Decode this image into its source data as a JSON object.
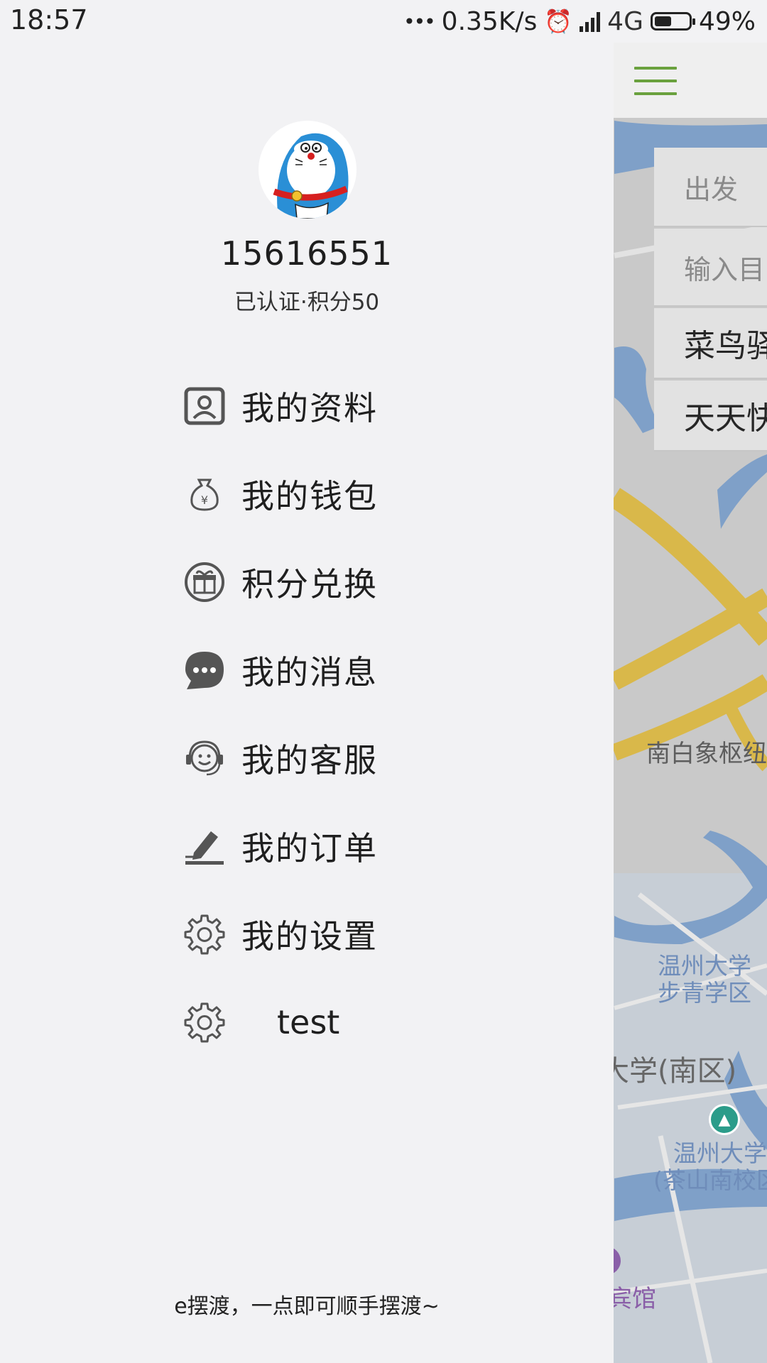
{
  "status_bar": {
    "time": "18:57",
    "more": "•••",
    "net_speed": "0.35K/s",
    "network": "4G",
    "battery": "49%",
    "battery_level": 0.49
  },
  "drawer": {
    "username": "15616551",
    "meta": "已认证·积分50",
    "menu": [
      {
        "label": "我的资料",
        "icon": "profile-card-icon"
      },
      {
        "label": "我的钱包",
        "icon": "money-bag-icon"
      },
      {
        "label": "积分兑换",
        "icon": "gift-icon"
      },
      {
        "label": "我的消息",
        "icon": "message-bubble-icon"
      },
      {
        "label": "我的客服",
        "icon": "customer-service-icon"
      },
      {
        "label": "我的订单",
        "icon": "pen-order-icon"
      },
      {
        "label": "我的设置",
        "icon": "gear-icon"
      },
      {
        "label": "test",
        "icon": "gear-icon"
      }
    ],
    "slogan": "e摆渡，一点即可顺手摆渡~"
  },
  "map_view": {
    "route_cards": [
      "出发",
      "输入目",
      "菜鸟驿",
      "天天快"
    ],
    "labels": [
      "南白象枢纽",
      "温州大学",
      "步青学区",
      "大学(南区)",
      "温州大学",
      "(茶山南校区",
      "宾馆"
    ]
  },
  "colors": {
    "drawer_bg": "#f2f2f4",
    "hamburger": "#6aa13e",
    "road": "#d9b84a",
    "water": "#7fa0c8"
  }
}
